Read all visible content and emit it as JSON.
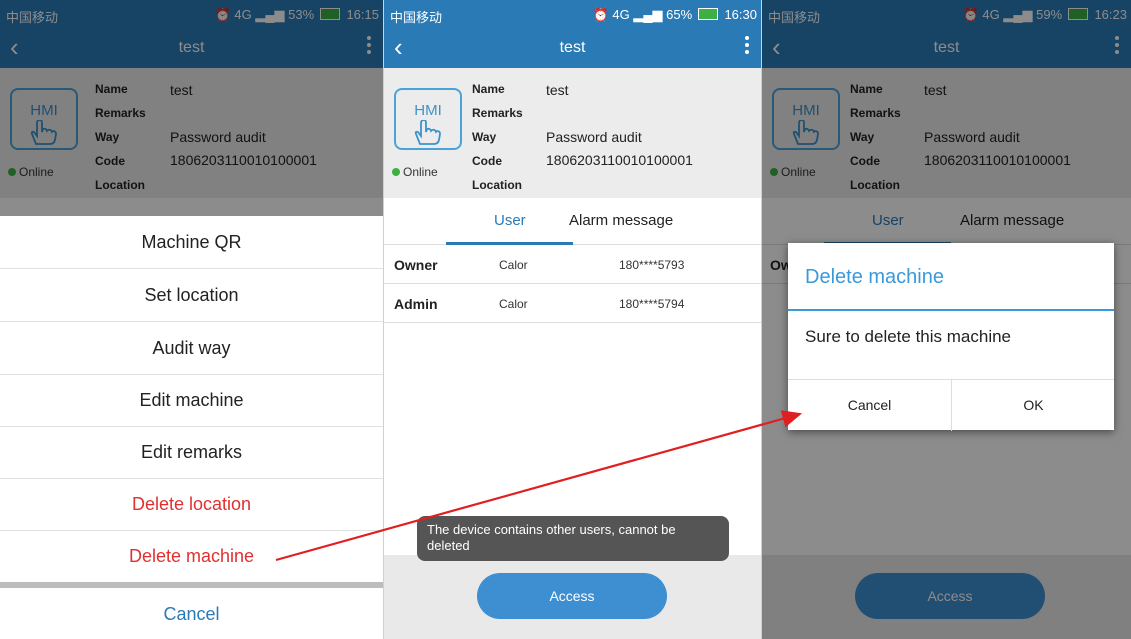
{
  "colors": {
    "accent": "#2a7ab6",
    "danger": "#e03030",
    "dialog_title": "#3a9ad9",
    "online": "#3cb043"
  },
  "panel1": {
    "status": {
      "carrier": "中国移动",
      "network": "4G",
      "battery": "53%",
      "time": "16:15"
    },
    "title": "test",
    "device": {
      "logo": "HMI",
      "status": "Online",
      "name_label": "Name",
      "name_value": "test",
      "remarks_label": "Remarks",
      "way_label": "Way",
      "way_value": "Password audit",
      "code_label": "Code",
      "code_value": "1806203110010100001",
      "location_label": "Location"
    },
    "menu": [
      "Machine QR",
      "Set location",
      "Audit way",
      "Edit machine",
      "Edit remarks",
      "Delete location",
      "Delete machine"
    ],
    "cancel": "Cancel"
  },
  "panel2": {
    "status": {
      "carrier": "中国移动",
      "network": "4G",
      "battery": "65%",
      "time": "16:30"
    },
    "title": "test",
    "device": {
      "logo": "HMI",
      "status": "Online",
      "name_label": "Name",
      "name_value": "test",
      "remarks_label": "Remarks",
      "way_label": "Way",
      "way_value": "Password audit",
      "code_label": "Code",
      "code_value": "1806203110010100001",
      "location_label": "Location"
    },
    "tabs": [
      "User",
      "Alarm message"
    ],
    "users": [
      {
        "role": "Owner",
        "name": "Calor",
        "phone": "180****5793"
      },
      {
        "role": "Admin",
        "name": "Calor",
        "phone": "180****5794"
      }
    ],
    "toast": "The device contains other users, cannot be deleted",
    "access": "Access"
  },
  "panel3": {
    "status": {
      "carrier": "中国移动",
      "network": "4G",
      "battery": "59%",
      "time": "16:23"
    },
    "title": "test",
    "device": {
      "logo": "HMI",
      "status": "Online",
      "name_label": "Name",
      "name_value": "test",
      "remarks_label": "Remarks",
      "way_label": "Way",
      "way_value": "Password audit",
      "code_label": "Code",
      "code_value": "1806203110010100001",
      "location_label": "Location"
    },
    "tabs": [
      "User",
      "Alarm message"
    ],
    "row_stub": "Ow",
    "dialog": {
      "title": "Delete machine",
      "message": "Sure to delete this machine",
      "cancel": "Cancel",
      "ok": "OK"
    },
    "access": "Access"
  }
}
